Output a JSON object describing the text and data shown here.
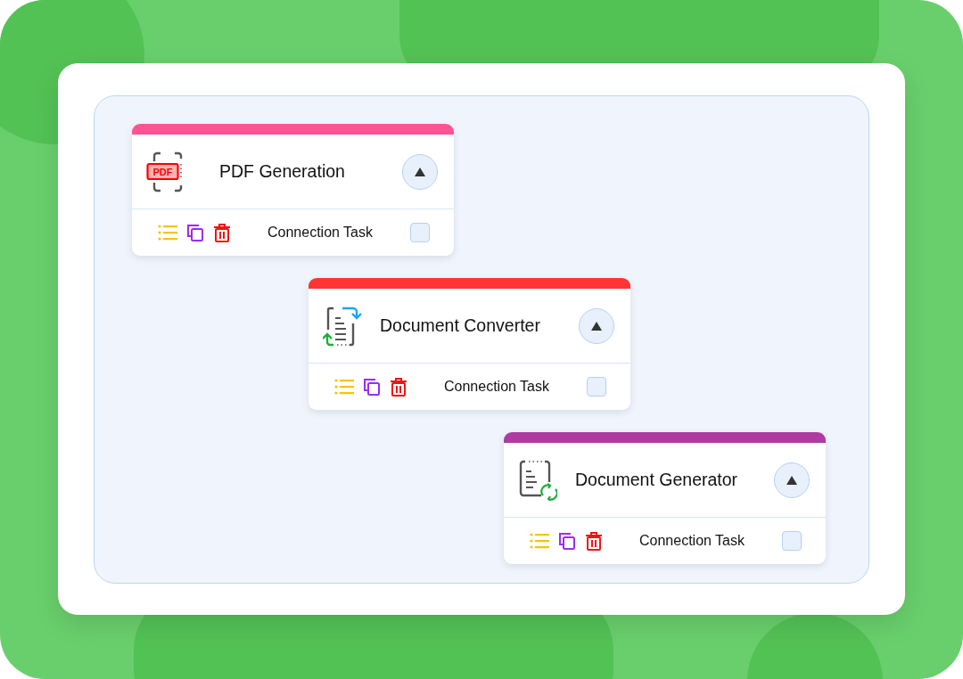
{
  "cards": [
    {
      "title": "PDF Generation",
      "kind": "pdf",
      "icon_label": "PDF",
      "color": "#ff5394",
      "footer_label": "Connection Task",
      "checked": false
    },
    {
      "title": "Document Converter",
      "kind": "convert",
      "color": "#ff3535",
      "footer_label": "Connection Task",
      "checked": false
    },
    {
      "title": "Document Generator",
      "kind": "generate",
      "color": "#b03ba0",
      "footer_label": "Connection Task",
      "checked": false
    }
  ]
}
